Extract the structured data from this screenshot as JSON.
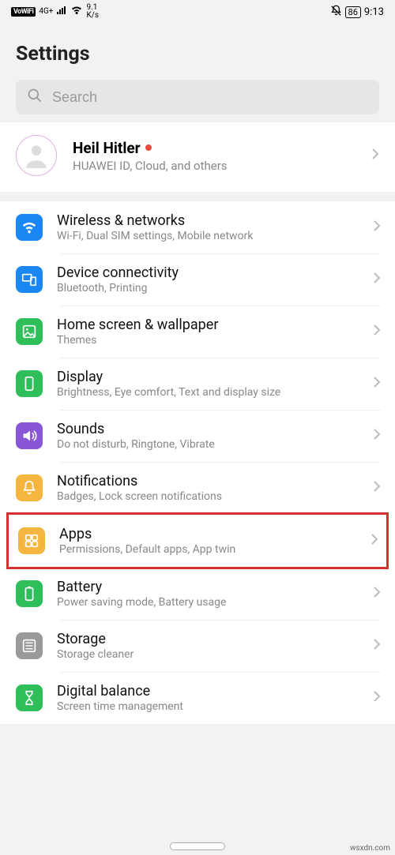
{
  "status": {
    "vowifi": "VoWiFi",
    "signal_label": "4G+",
    "speed_top": "9.1",
    "speed_bot": "K/s",
    "battery": "86",
    "time": "9:13"
  },
  "header": {
    "title": "Settings"
  },
  "search": {
    "placeholder": "Search"
  },
  "profile": {
    "name": "Heil Hitler",
    "sub": "HUAWEI ID, Cloud, and others"
  },
  "rows": {
    "wireless": {
      "title": "Wireless & networks",
      "sub": "Wi-Fi, Dual SIM settings, Mobile network",
      "color": "#1a88f0"
    },
    "device": {
      "title": "Device connectivity",
      "sub": "Bluetooth, Printing",
      "color": "#1a88f0"
    },
    "home": {
      "title": "Home screen & wallpaper",
      "sub": "Themes",
      "color": "#2fbf5a"
    },
    "display": {
      "title": "Display",
      "sub": "Brightness, Eye comfort, Text and display size",
      "color": "#2fbf5a"
    },
    "sounds": {
      "title": "Sounds",
      "sub": "Do not disturb, Ringtone, Vibrate",
      "color": "#8856d6"
    },
    "notifications": {
      "title": "Notifications",
      "sub": "Badges, Lock screen notifications",
      "color": "#f4b63f"
    },
    "apps": {
      "title": "Apps",
      "sub": "Permissions, Default apps, App twin",
      "color": "#f4b63f"
    },
    "battery": {
      "title": "Battery",
      "sub": "Power saving mode, Battery usage",
      "color": "#2fbf5a"
    },
    "storage": {
      "title": "Storage",
      "sub": "Storage cleaner",
      "color": "#9a9a9a"
    },
    "digital": {
      "title": "Digital balance",
      "sub": "Screen time management",
      "color": "#2fbf5a"
    }
  },
  "watermark": "wsxdn.com"
}
